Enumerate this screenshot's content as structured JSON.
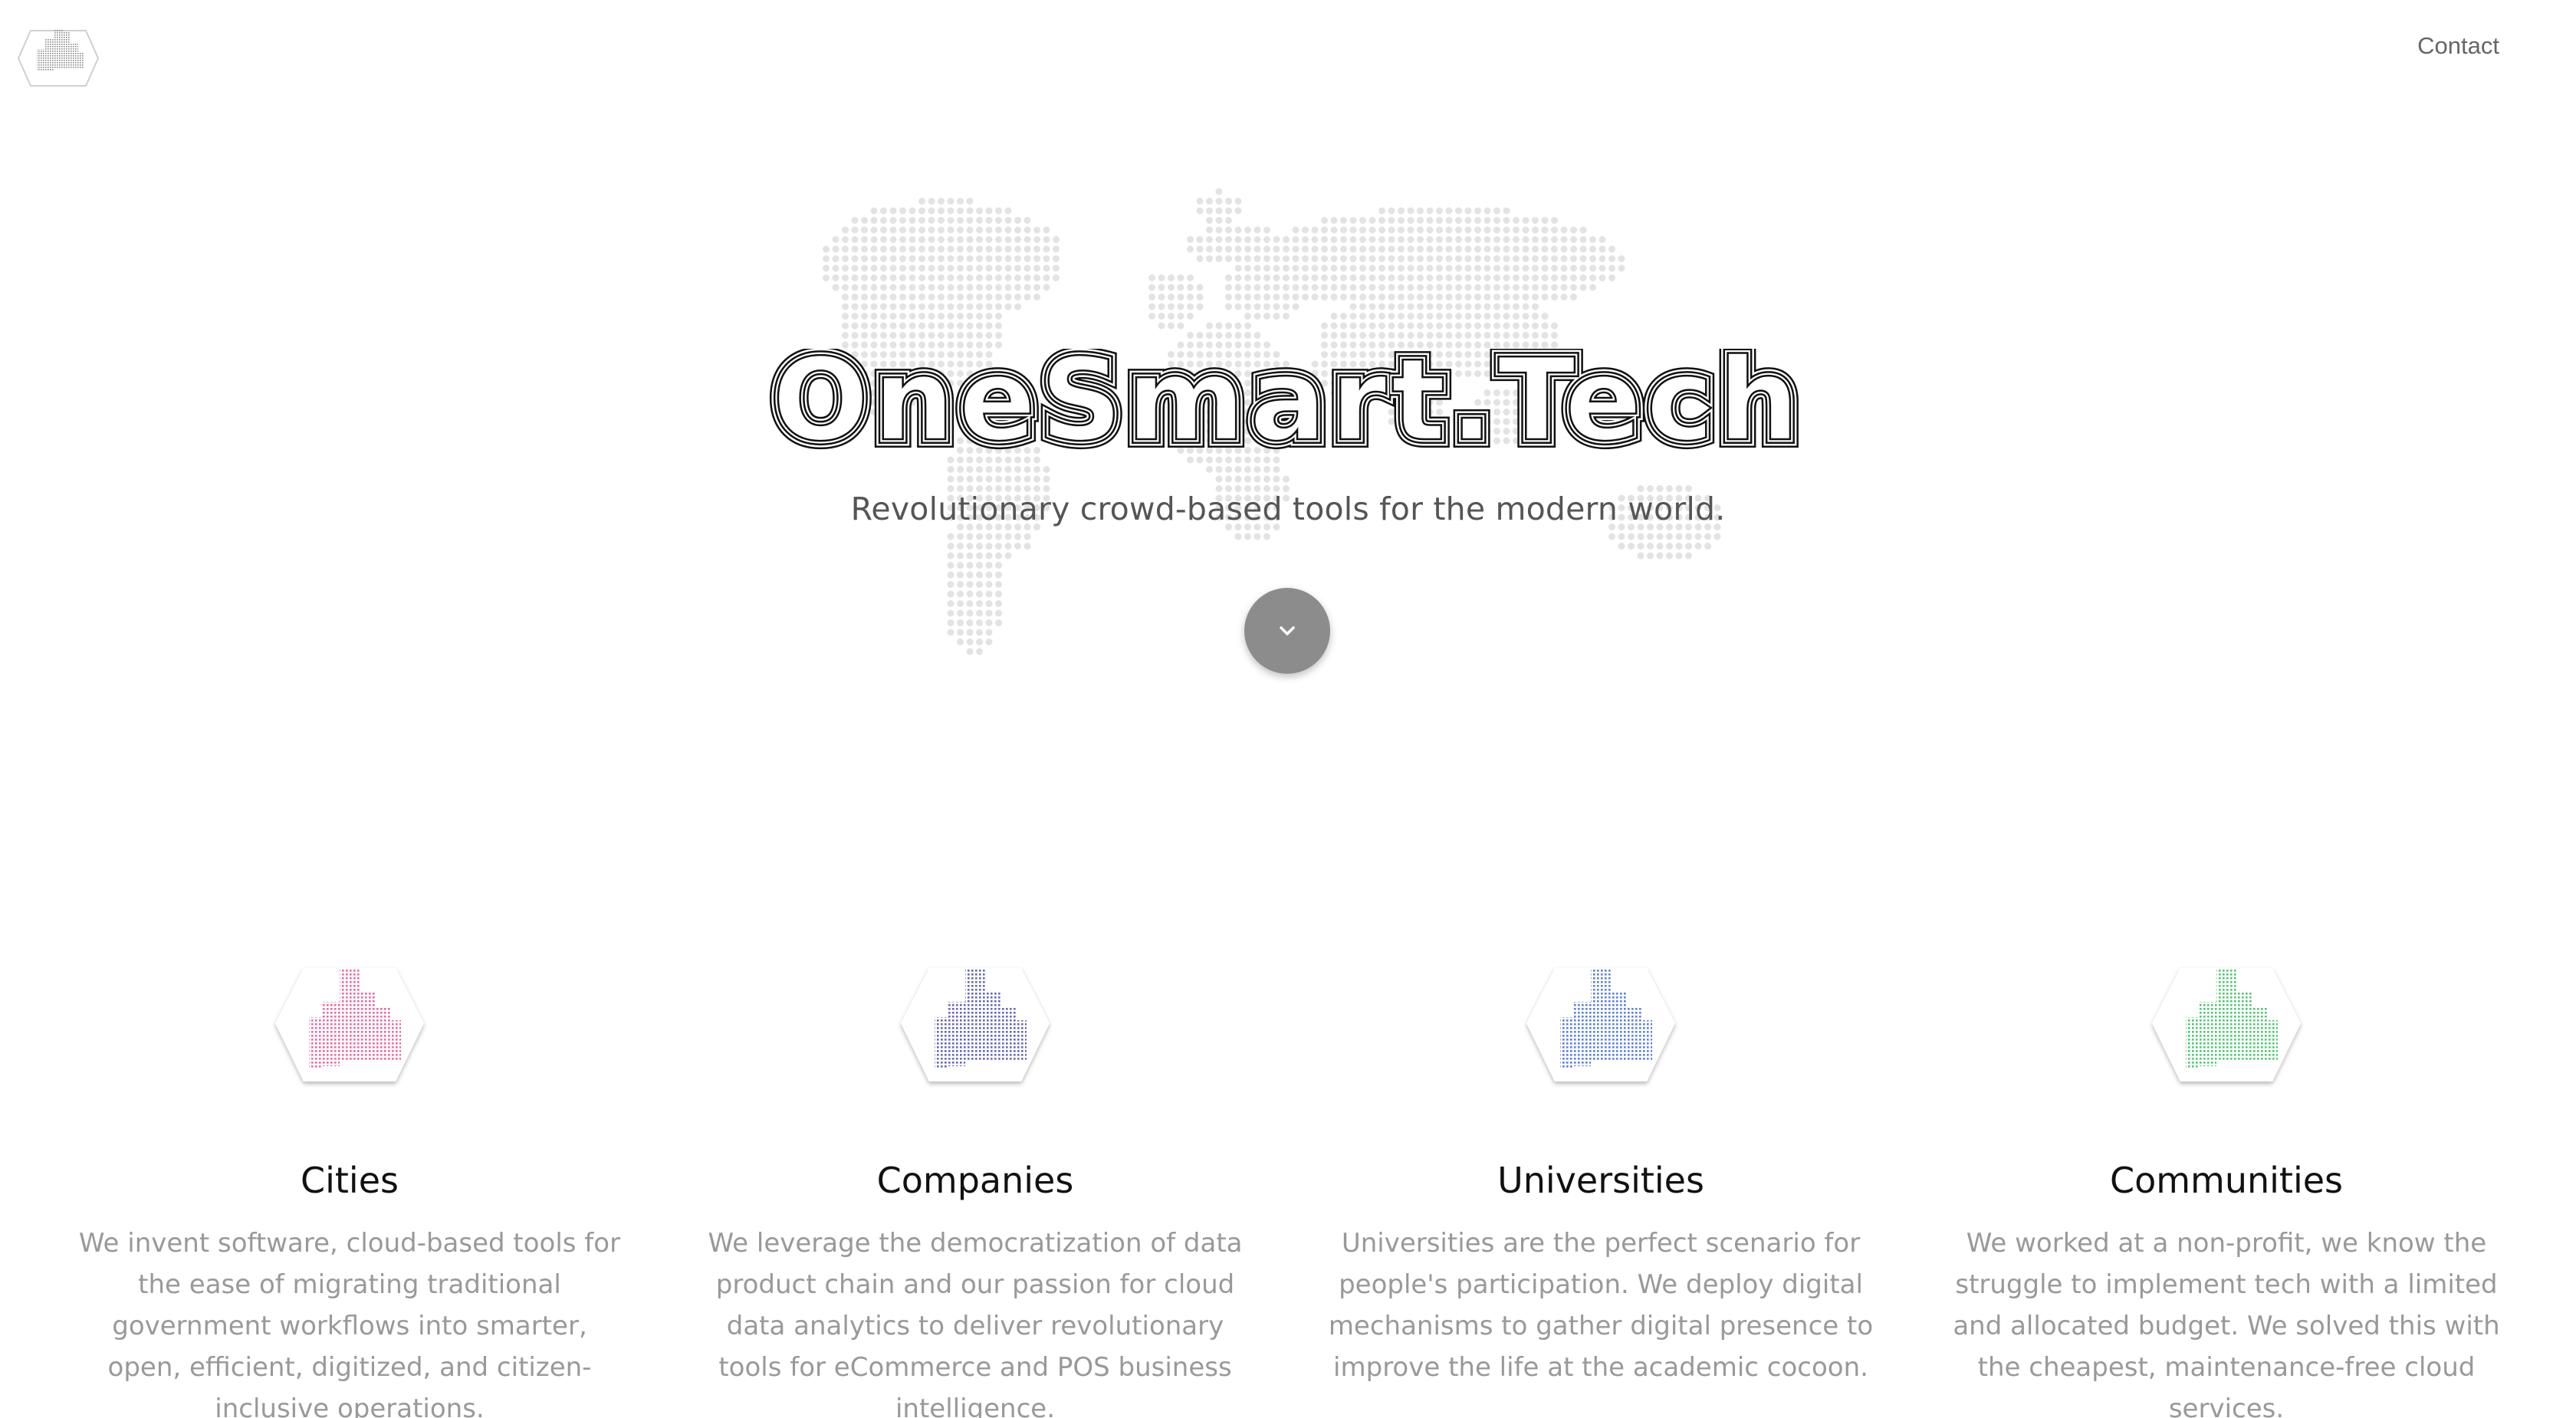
{
  "nav": {
    "logo_icon": "city-hexagon-logo-icon",
    "contact_label": "Contact"
  },
  "hero": {
    "brand_title": "OneSmart.Tech",
    "tagline": "Revolutionary crowd-based tools for the modern world.",
    "background_icon": "dotted-world-map",
    "scroll_icon": "chevron-down-icon"
  },
  "features": [
    {
      "title": "Cities",
      "icon": "city-skyline-icon",
      "color": "#ec6aa0",
      "description": "We invent software, cloud-based tools for the ease of migrating traditional government workflows into smarter, open, efficient, digitized, and citizen-inclusive operations."
    },
    {
      "title": "Companies",
      "icon": "city-skyline-icon",
      "color": "#6667b9",
      "description": "We leverage the democratization of data product chain and our passion for cloud data analytics to deliver revolutionary tools for eCommerce and POS business intelligence."
    },
    {
      "title": "Universities",
      "icon": "city-skyline-icon",
      "color": "#5a7fe6",
      "description": "Universities are the perfect scenario for people's participation. We deploy digital mechanisms to gather digital presence to improve the life at the academic cocoon."
    },
    {
      "title": "Communities",
      "icon": "city-skyline-icon",
      "color": "#4fc872",
      "description": "We worked at a non-profit, we know the struggle to implement tech with a limited and allocated budget. We solved this with the cheapest, maintenance-free cloud services."
    }
  ],
  "colors": {
    "background": "#ffffff",
    "map_dots": "#e3e3e3",
    "scroll_button": "#8c8c8c",
    "body_text": "#999999",
    "logo_gray": "#8a8a8a"
  }
}
